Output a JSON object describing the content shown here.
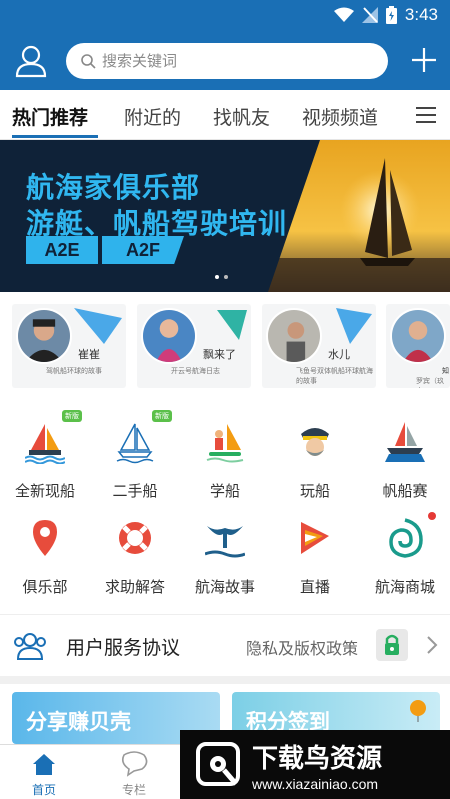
{
  "status_bar": {
    "time": "3:43"
  },
  "search": {
    "placeholder": "搜索关键词"
  },
  "tabs": [
    {
      "label": "热门推荐",
      "active": true
    },
    {
      "label": "附近的"
    },
    {
      "label": "找帆友"
    },
    {
      "label": "视频频道"
    }
  ],
  "banner": {
    "line1": "航海家俱乐部",
    "line2": "游艇、帆船驾驶培训",
    "tag1": "A2E",
    "tag2": "A2F",
    "page_dots": 2
  },
  "stories": [
    {
      "name": "崔崔",
      "desc": "驾帆船环球的故事"
    },
    {
      "name": "飘来了",
      "desc": "开云号航海日志"
    },
    {
      "name": "水儿",
      "desc": "飞鱼号双体帆船环球航海的故事"
    },
    {
      "name": "知",
      "desc": "罗宾（玖大"
    }
  ],
  "grid": [
    {
      "label": "全新现船",
      "icon": "sailboat-waves-icon",
      "badge": "新版"
    },
    {
      "label": "二手船",
      "icon": "sailboat-outline-icon",
      "badge": "新版"
    },
    {
      "label": "学船",
      "icon": "windsurf-icon"
    },
    {
      "label": "玩船",
      "icon": "captain-icon"
    },
    {
      "label": "帆船赛",
      "icon": "race-boat-icon"
    },
    {
      "label": "俱乐部",
      "icon": "location-pin-icon"
    },
    {
      "label": "求助解答",
      "icon": "lifebuoy-icon"
    },
    {
      "label": "航海故事",
      "icon": "whale-tail-icon"
    },
    {
      "label": "直播",
      "icon": "live-sail-icon"
    },
    {
      "label": "航海商城",
      "icon": "shell-icon"
    }
  ],
  "notice": {
    "title": "用户服务协议",
    "policy": "隐私及版权政策"
  },
  "cards": [
    {
      "label": "分享赚贝壳",
      "color": "#6cc6ee"
    },
    {
      "label": "积分签到",
      "color": "#7ccfe6"
    }
  ],
  "bottom_nav": [
    {
      "label": "首页",
      "active": true
    },
    {
      "label": "专栏"
    }
  ],
  "watermark": {
    "title": "下载鸟资源",
    "url": "www.xiazainiao.com"
  },
  "colors": {
    "primary": "#1a6fb5",
    "banner_text": "#30b7f0",
    "banner_bg": "#0f2238"
  }
}
